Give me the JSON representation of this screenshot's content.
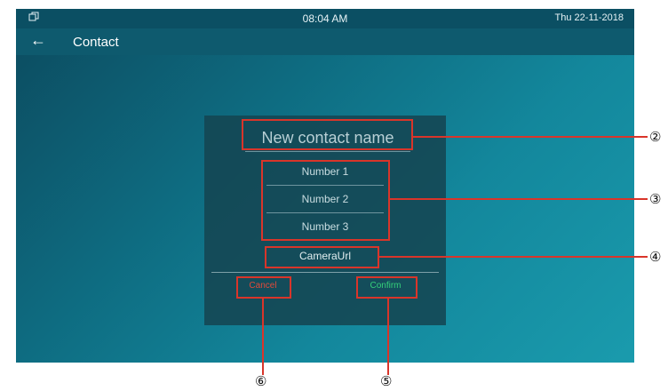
{
  "statusbar": {
    "icon": "window-icon",
    "time": "08:04 AM",
    "date": "Thu   22-11-2018"
  },
  "titlebar": {
    "back_icon": "back-arrow-icon",
    "back_glyph": "←",
    "title": "Contact"
  },
  "dialog": {
    "name_placeholder": "New contact name",
    "numbers": [
      "Number 1",
      "Number 2",
      "Number 3"
    ],
    "camera_placeholder": "CameraUrl",
    "cancel_label": "Cancel",
    "confirm_label": "Confirm"
  },
  "callouts": {
    "c2": "②",
    "c3": "③",
    "c4": "④",
    "c5": "⑤",
    "c6": "⑥"
  },
  "colors": {
    "highlight": "#d9352a",
    "cancel": "#e04a3a",
    "confirm": "#35d07a"
  }
}
